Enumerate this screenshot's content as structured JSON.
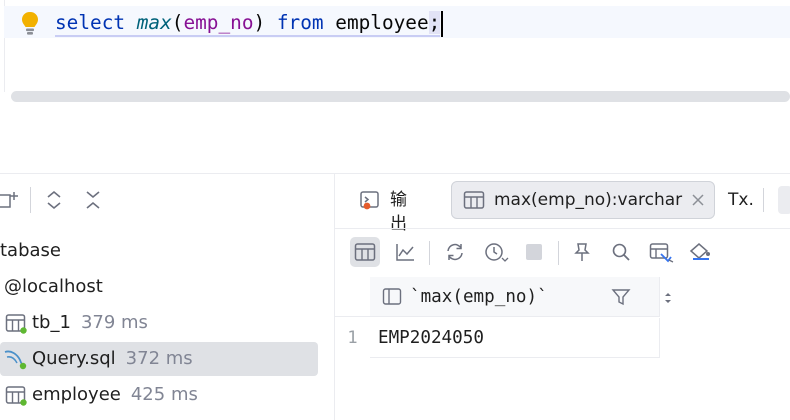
{
  "editor": {
    "tokens": {
      "select": "select",
      "max": "max",
      "open_paren": "(",
      "arg": "emp_no",
      "close_paren": ")",
      "from": "from",
      "table": "employee",
      "semicolon": ";"
    }
  },
  "tree": {
    "root_label": "tabase",
    "host_label": "@localhost",
    "items": [
      {
        "label": "tb_1",
        "meta": "379 ms"
      },
      {
        "label": "Query.sql",
        "meta": "372 ms"
      },
      {
        "label": "employee",
        "meta": "425 ms"
      }
    ]
  },
  "tabs": {
    "output_label": "输出",
    "result_label": "max(emp_no):varchar",
    "tx_label": "Tx."
  },
  "table": {
    "column_header": "`max(emp_no)`",
    "rows": [
      {
        "num": "1",
        "value": "EMP2024050"
      }
    ]
  },
  "colors": {
    "keyword": "#0033b3",
    "function": "#00627a",
    "identifier": "#871094",
    "bulb": "#f2b100",
    "active_badge": "#5fb832"
  }
}
